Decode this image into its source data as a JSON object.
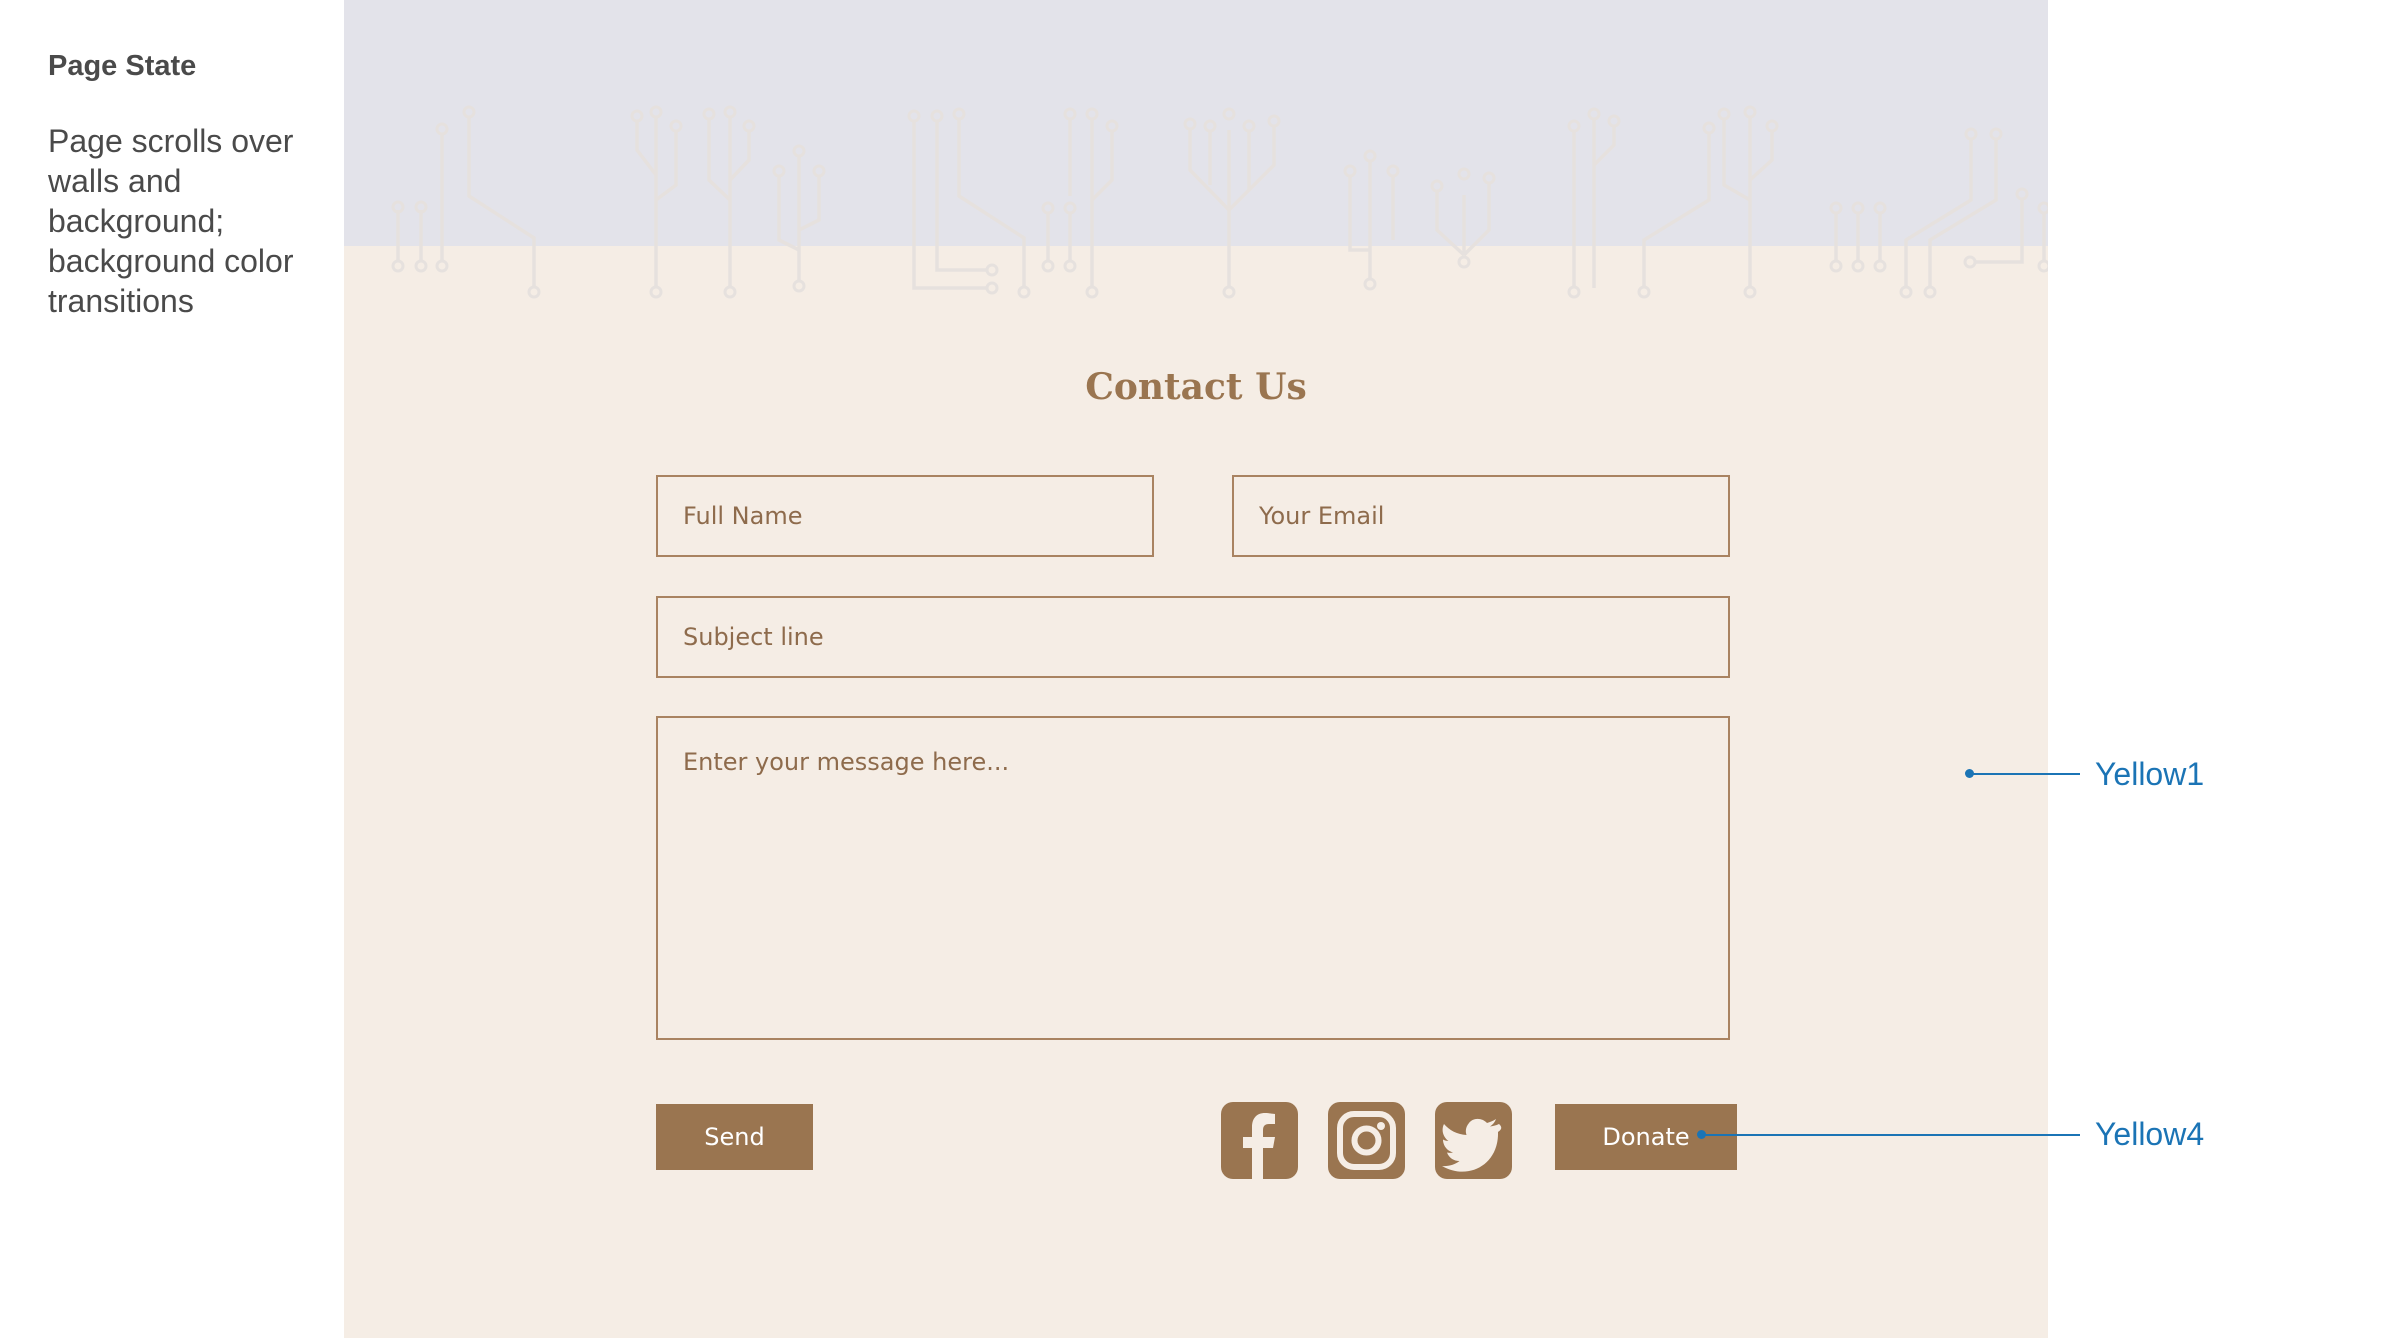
{
  "notes": {
    "title": "Page State",
    "body": "Page scrolls over walls and background; background color transitions"
  },
  "form": {
    "heading": "Contact Us",
    "full_name_placeholder": "Full Name",
    "email_placeholder": "Your Email",
    "subject_placeholder": "Subject line",
    "message_placeholder": "Enter your message here...",
    "send_label": "Send",
    "donate_label": "Donate"
  },
  "social": {
    "icons": [
      "facebook-icon",
      "instagram-icon",
      "twitter-icon"
    ]
  },
  "annotations": {
    "background_label": "Yellow1",
    "donate_label": "Yellow4"
  },
  "colors": {
    "page_bg": "#f5ede5",
    "sky": "#e3e3ea",
    "accent": "#9a7550",
    "field_border": "#a98361",
    "annotation": "#1b74b5"
  }
}
